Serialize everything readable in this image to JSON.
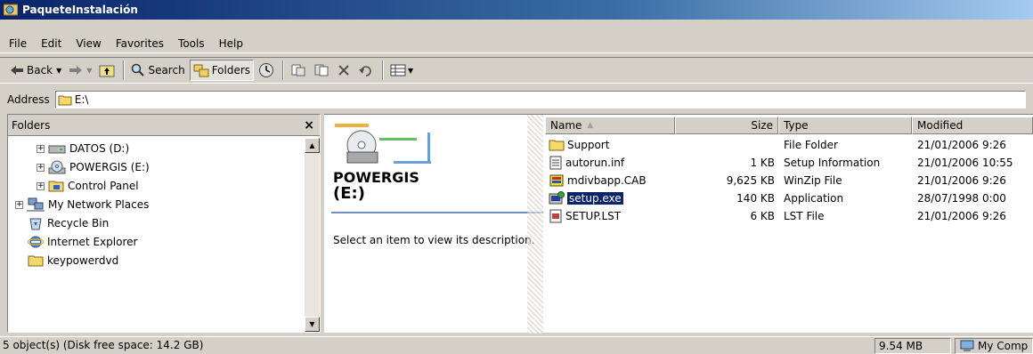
{
  "window": {
    "title": "PaqueteInstalación"
  },
  "menu": [
    "File",
    "Edit",
    "View",
    "Favorites",
    "Tools",
    "Help"
  ],
  "toolbar": {
    "back": "Back",
    "search": "Search",
    "folders": "Folders"
  },
  "address": {
    "label": "Address",
    "value": "E:\\"
  },
  "folders_pane": {
    "title": "Folders",
    "close": "×",
    "tree": [
      "DATOS (D:)",
      "POWERGIS (E:)",
      "Control Panel",
      "My Network Places",
      "Recycle Bin",
      "Internet Explorer",
      "keypowerdvd"
    ]
  },
  "web_view": {
    "drive_name": "POWERGIS",
    "drive_letter": "(E:)",
    "description": "Select an item to view its description."
  },
  "columns": {
    "name": "Name",
    "size": "Size",
    "type": "Type",
    "modified": "Modified"
  },
  "files": [
    {
      "name": "Support",
      "size": "",
      "type": "File Folder",
      "modified": "21/01/2006 9:26",
      "icon": "folder-icon"
    },
    {
      "name": "autorun.inf",
      "size": "1 KB",
      "type": "Setup Information",
      "modified": "21/01/2006 10:55",
      "icon": "inf-file-icon"
    },
    {
      "name": "mdivbapp.CAB",
      "size": "9,625 KB",
      "type": "WinZip File",
      "modified": "21/01/2006 9:26",
      "icon": "winzip-icon"
    },
    {
      "name": "setup.exe",
      "size": "140 KB",
      "type": "Application",
      "modified": "28/07/1998 0:00",
      "icon": "setup-exe-icon"
    },
    {
      "name": "SETUP.LST",
      "size": "6 KB",
      "type": "LST File",
      "modified": "21/01/2006 9:26",
      "icon": "lst-file-icon"
    }
  ],
  "status": {
    "objects": "5 object(s) (Disk free space: 14.2 GB)",
    "size": "9.54 MB",
    "zone": "My Comp"
  }
}
